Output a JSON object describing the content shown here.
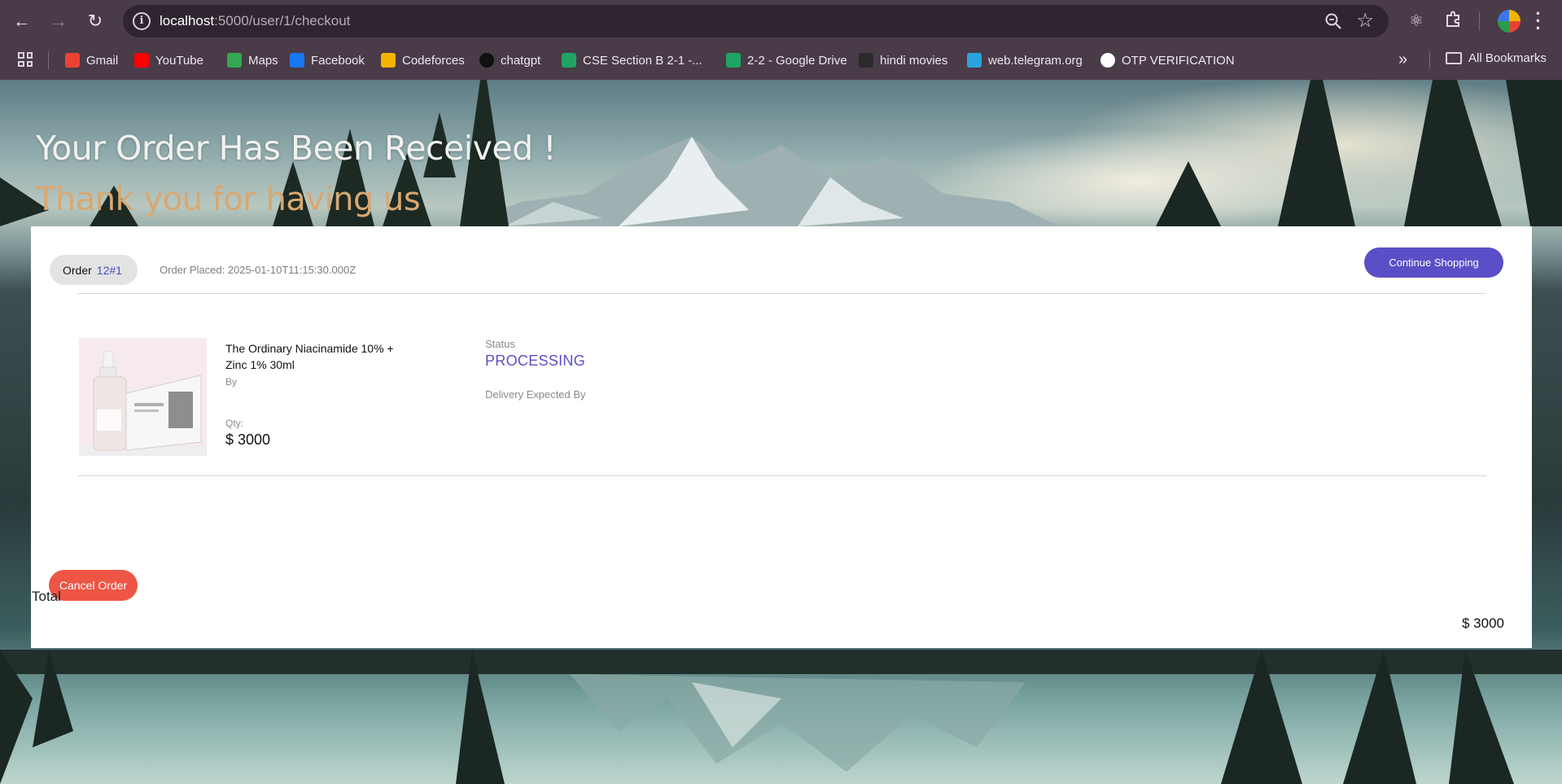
{
  "browser": {
    "url_host": "localhost",
    "url_path": ":5000/user/1/checkout",
    "bookmarks": [
      {
        "label": "Gmail",
        "icon": "gmail-icon",
        "color": "#ea4335"
      },
      {
        "label": "YouTube",
        "icon": "youtube-icon",
        "color": "#ff0000"
      },
      {
        "label": "Maps",
        "icon": "maps-icon",
        "color": "#34a853"
      },
      {
        "label": "Facebook",
        "icon": "facebook-icon",
        "color": "#1877f2"
      },
      {
        "label": "Codeforces",
        "icon": "codeforces-icon",
        "color": "#f4b400"
      },
      {
        "label": "chatgpt",
        "icon": "chatgpt-icon",
        "color": "#111111"
      },
      {
        "label": "CSE Section B 2-1 -...",
        "icon": "google-drive-icon",
        "color": "#1fa463"
      },
      {
        "label": "2-2 - Google Drive",
        "icon": "google-drive-icon",
        "color": "#1fa463"
      },
      {
        "label": "hindi movies",
        "icon": "movies-icon",
        "color": "#2b2b2b"
      },
      {
        "label": "web.telegram.org",
        "icon": "telegram-icon",
        "color": "#2aa3df"
      },
      {
        "label": "OTP VERIFICATION",
        "icon": "github-icon",
        "color": "#ffffff"
      }
    ],
    "all_bookmarks": "All Bookmarks",
    "accent": "#4a3b48"
  },
  "hero": {
    "title": "Your Order Has Been Received !",
    "subtitle": "Thank you for having us"
  },
  "order": {
    "label": "Order",
    "id": "12#1",
    "placed": "Order Placed: 2025-01-10T11:15:30.000Z",
    "continue_label": "Continue Shopping",
    "cancel_label": "Cancel Order",
    "total_label": "Total",
    "total_value": "$ 3000",
    "accent": "#5a4fc6",
    "cancel_color": "#ee5544"
  },
  "item": {
    "name": "The Ordinary Niacinamide 10% + Zinc 1% 30ml",
    "by_label": "By",
    "qty_label": "Qty:",
    "price": "$ 3000",
    "status_label": "Status",
    "status_value": "PROCESSING",
    "delivery_label": "Delivery Expected By"
  }
}
